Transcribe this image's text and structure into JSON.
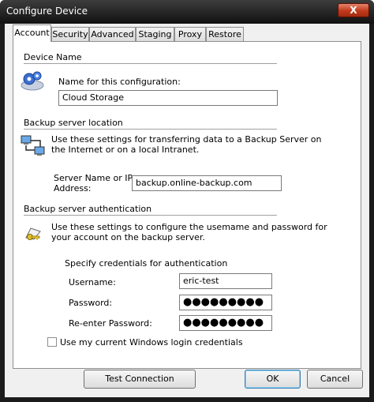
{
  "window": {
    "title": "Configure Device",
    "close_label": "X"
  },
  "tabs": [
    "Account",
    "Security",
    "Advanced",
    "Staging",
    "Proxy",
    "Restore"
  ],
  "device_name": {
    "heading": "Device Name",
    "label": "Name for this configuration:",
    "value": "Cloud Storage",
    "icon": "gears-icon"
  },
  "server": {
    "heading": "Backup server location",
    "description_line1": "Use these settings for transferring data to a Backup Server on",
    "description_line2": "the Internet or on a local Intranet.",
    "label_line1": "Server Name or IP",
    "label_line2": "Address:",
    "value": "backup.online-backup.com",
    "icon": "network-computers-icon"
  },
  "auth": {
    "heading": "Backup server authentication",
    "description_line1": "Use these settings to configure the usemame and password for",
    "description_line2": "your account on the backup server.",
    "credentials_label": "Specify credentials for authentication",
    "username_label": "Username:",
    "username_value": "eric-test",
    "password_label": "Password:",
    "password_value": "●●●●●●●●●",
    "reenter_label": "Re-enter Password:",
    "reenter_value": "●●●●●●●●●",
    "windows_login_label": "Use my current Windows login credentials",
    "windows_login_checked": false,
    "icon": "key-icon"
  },
  "buttons": {
    "test": "Test Connection",
    "ok": "OK",
    "cancel": "Cancel"
  }
}
